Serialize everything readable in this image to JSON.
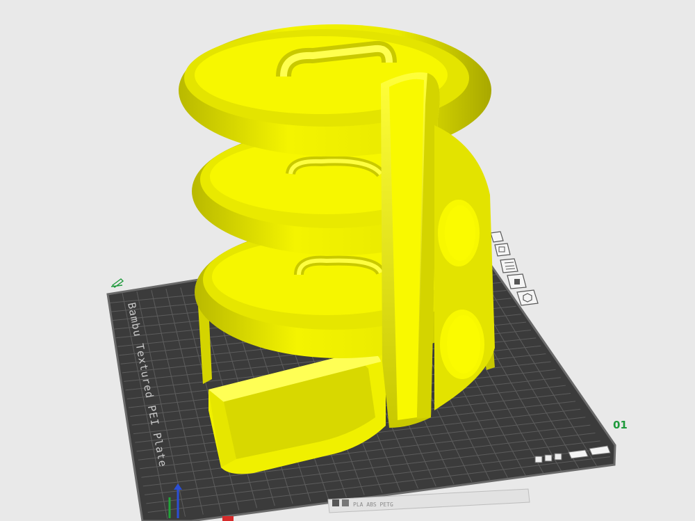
{
  "viewport": {
    "background": "#e9e9e9",
    "model_color": "#f2f200",
    "plate_color": "#3b3b3b",
    "grid_color": "#5a5a5a"
  },
  "plate": {
    "label": "Bambu Textured PEI Plate",
    "number": "01",
    "filament_tag": "PLA ABS PETG",
    "number_color": "#1f9a3c"
  },
  "plate_icons": [
    {
      "name": "arrange-icon"
    },
    {
      "name": "orient-icon"
    },
    {
      "name": "layout-icon"
    },
    {
      "name": "lock-icon"
    },
    {
      "name": "settings-icon"
    }
  ],
  "axis_colors": {
    "x": "#d62b2b",
    "y": "#23a33a",
    "z": "#2b4fd6"
  }
}
